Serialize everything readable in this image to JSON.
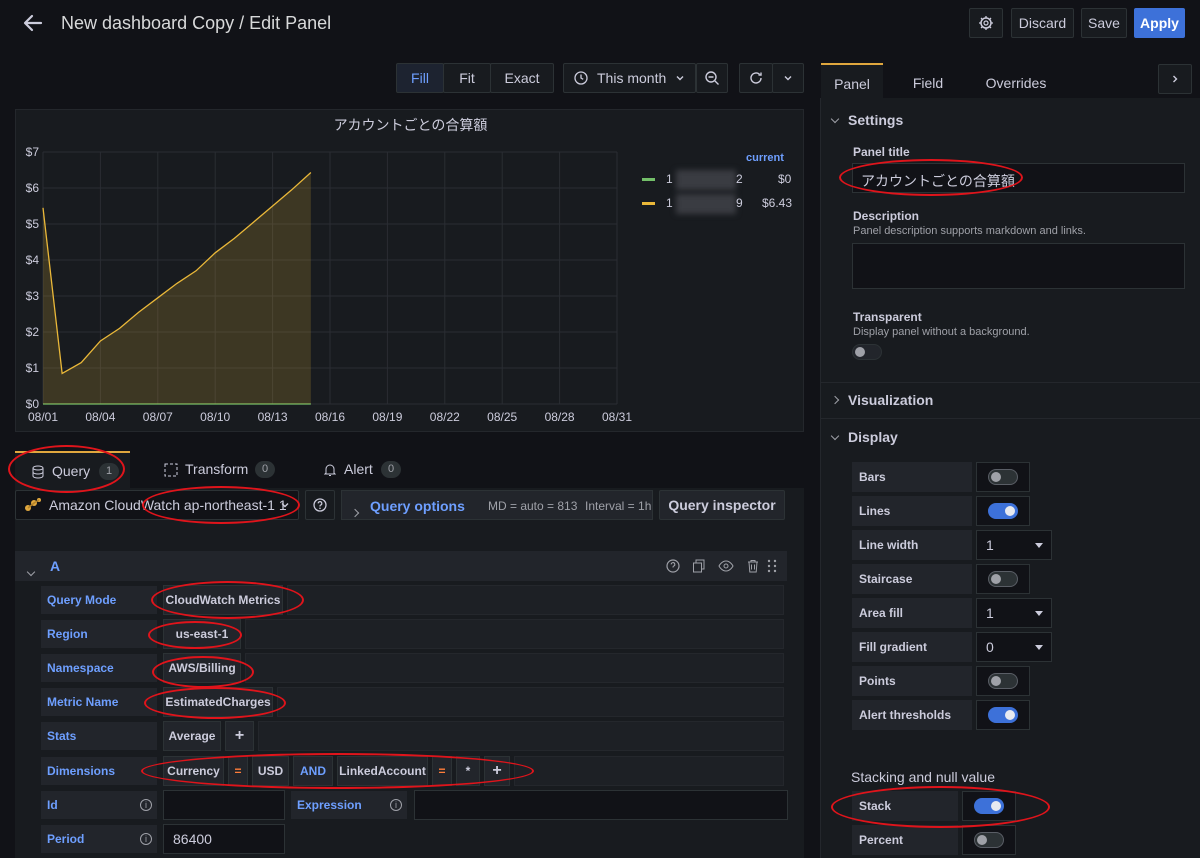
{
  "header": {
    "title": "New dashboard Copy / Edit Panel",
    "discard": "Discard",
    "save": "Save",
    "apply": "Apply"
  },
  "toolbar": {
    "fill": "Fill",
    "fit": "Fit",
    "exact": "Exact",
    "time_range": "This month"
  },
  "chart_data": {
    "type": "line",
    "title": "アカウントごとの合算額",
    "x_ticks": [
      "08/01",
      "08/04",
      "08/07",
      "08/10",
      "08/13",
      "08/16",
      "08/19",
      "08/22",
      "08/25",
      "08/28",
      "08/31"
    ],
    "y_ticks": [
      "$0",
      "$1",
      "$2",
      "$3",
      "$4",
      "$5",
      "$6",
      "$7"
    ],
    "ylim": [
      0,
      7
    ],
    "legend_header": "current",
    "series": [
      {
        "label_start": "1",
        "label_end": "2",
        "current": "$0",
        "color": "#73bf69",
        "x": [
          0,
          14
        ],
        "y": [
          0,
          0
        ]
      },
      {
        "label_start": "1",
        "label_end": "9",
        "current": "$6.43",
        "color": "#eab839",
        "x": [
          0,
          1,
          2,
          3,
          4,
          5,
          6,
          7,
          8,
          9,
          10,
          11,
          12,
          13,
          14
        ],
        "y": [
          5.45,
          0.85,
          1.15,
          1.75,
          2.1,
          2.55,
          2.95,
          3.35,
          3.7,
          4.2,
          4.6,
          5.05,
          5.5,
          5.95,
          6.43
        ]
      }
    ]
  },
  "tabs": {
    "query": "Query",
    "query_count": "1",
    "transform": "Transform",
    "transform_count": "0",
    "alert": "Alert",
    "alert_count": "0"
  },
  "datasource": {
    "name": "Amazon CloudWatch ap-northeast-1 1",
    "query_options": "Query options",
    "md": "MD = auto = 813",
    "interval": "Interval = 1h",
    "inspector": "Query inspector"
  },
  "query": {
    "ref": "A",
    "rows": {
      "mode_label": "Query Mode",
      "mode_value": "CloudWatch Metrics",
      "region_label": "Region",
      "region_value": "us-east-1",
      "namespace_label": "Namespace",
      "namespace_value": "AWS/Billing",
      "metric_label": "Metric Name",
      "metric_value": "EstimatedCharges",
      "stats_label": "Stats",
      "stats_value": "Average",
      "dims_label": "Dimensions",
      "dim1_key": "Currency",
      "dim_eq": "=",
      "dim1_val": "USD",
      "dim_and": "AND",
      "dim2_key": "LinkedAccount",
      "dim2_val": "*",
      "plus": "+",
      "id_label": "Id",
      "expression_label": "Expression",
      "period_label": "Period",
      "period_value": "86400"
    }
  },
  "options": {
    "tabs": [
      "Panel",
      "Field",
      "Overrides"
    ],
    "settings": "Settings",
    "panel_title_label": "Panel title",
    "panel_title_value": "アカウントごとの合算額",
    "description_label": "Description",
    "description_hint": "Panel description supports markdown and links.",
    "transparent_label": "Transparent",
    "transparent_hint": "Display panel without a background.",
    "visualization": "Visualization",
    "display": "Display",
    "bars": "Bars",
    "lines": "Lines",
    "line_width": "Line width",
    "line_width_value": "1",
    "staircase": "Staircase",
    "area_fill": "Area fill",
    "area_fill_value": "1",
    "fill_gradient": "Fill gradient",
    "fill_gradient_value": "0",
    "points": "Points",
    "alert_thresholds": "Alert thresholds",
    "stacking": "Stacking and null value",
    "stack": "Stack",
    "percent": "Percent"
  }
}
